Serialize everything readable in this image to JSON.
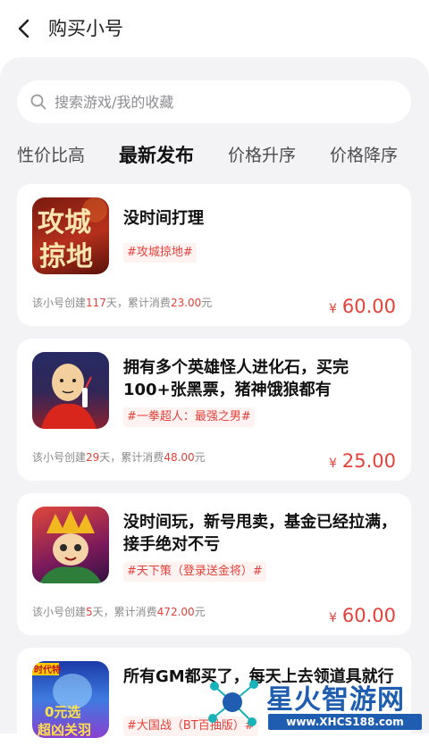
{
  "header": {
    "title": "购买小号"
  },
  "search": {
    "placeholder": "搜索游戏/我的收藏"
  },
  "tabs": [
    {
      "label": "性价比高",
      "active": false
    },
    {
      "label": "最新发布",
      "active": true
    },
    {
      "label": "价格升序",
      "active": false
    },
    {
      "label": "价格降序",
      "active": false
    }
  ],
  "listings": [
    {
      "title": "没时间打理",
      "tag": "#攻城掠地#",
      "meta_prefix": "该小号创建",
      "days": "117",
      "meta_mid": "天，累计消费",
      "spent": "23.00",
      "meta_suffix": "元",
      "currency": "¥",
      "price": "60.00",
      "thumb_text": [
        "攻城",
        "掠地"
      ]
    },
    {
      "title": "拥有多个英雄怪人进化石，买完100+张黑票，猪神饿狼都有",
      "tag": "#一拳超人：最强之男#",
      "meta_prefix": "该小号创建",
      "days": "29",
      "meta_mid": "天，累计消费",
      "spent": "48.00",
      "meta_suffix": "元",
      "currency": "¥",
      "price": "25.00"
    },
    {
      "title": "没时间玩，新号甩卖，基金已经拉满，接手绝对不亏",
      "tag": "#天下策（登录送金将）#",
      "meta_prefix": "该小号创建",
      "days": "5",
      "meta_mid": "天，累计消费",
      "spent": "472.00",
      "meta_suffix": "元",
      "currency": "¥",
      "price": "60.00"
    },
    {
      "title": "所有GM都买了，每天上去领道具就行",
      "tag": "#大国战（BT百抽版）#",
      "thumb_text": [
        "0元选",
        "超凶关羽"
      ],
      "thumb_badge": "时代特"
    }
  ],
  "watermark": {
    "name": "星火智游网",
    "url": "www.XHCS188.com"
  },
  "colors": {
    "accent": "#e5413b",
    "panel_bg": "#f3f3f5",
    "brand_blue": "#1e5db0"
  }
}
